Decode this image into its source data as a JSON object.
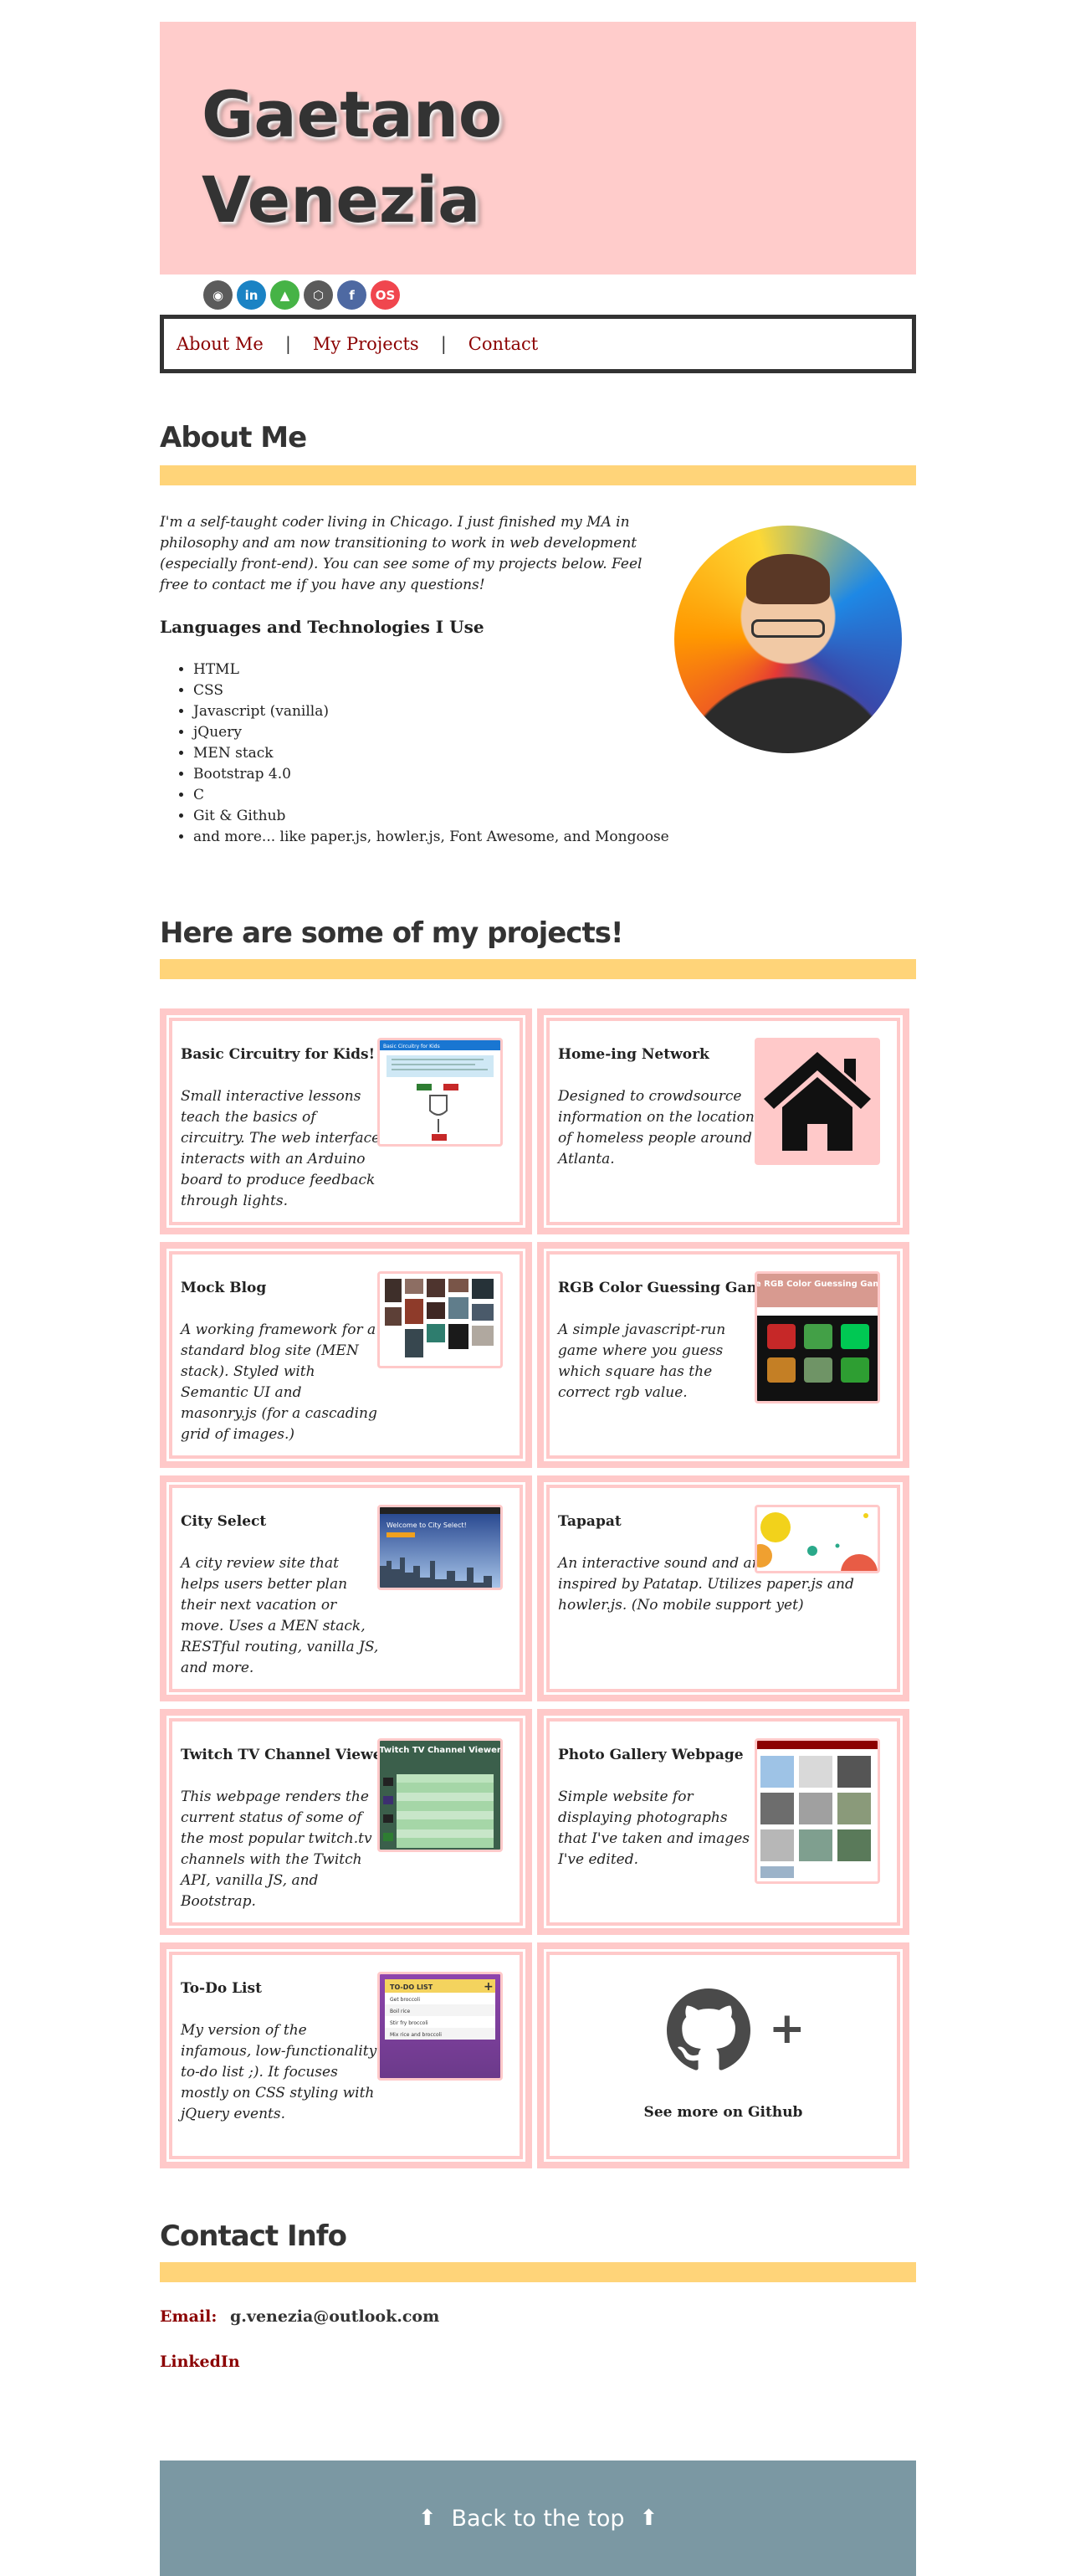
{
  "header": {
    "name_line1": "Gaetano",
    "name_line2": "Venezia"
  },
  "social": [
    {
      "icon": "github-icon",
      "glyph": "◉",
      "color": "#5b5b5b"
    },
    {
      "icon": "linkedin-icon",
      "glyph": "in",
      "color": "#1b83c4"
    },
    {
      "icon": "freecodecamp-icon",
      "glyph": "▲",
      "color": "#46b346"
    },
    {
      "icon": "codepen-icon",
      "glyph": "⬡",
      "color": "#5b5b5b"
    },
    {
      "icon": "facebook-icon",
      "glyph": "f",
      "color": "#4e69a2"
    },
    {
      "icon": "openprocessing-icon",
      "glyph": "OS",
      "color": "#f0464e"
    }
  ],
  "nav": {
    "about": "About Me",
    "sep": "|",
    "projects": "My Projects",
    "contact": "Contact"
  },
  "about": {
    "title": "About Me",
    "intro": "I'm a self-taught coder living in Chicago. I just finished my MA in philosophy and am now transitioning to work in web development (especially front-end). You can see some of my projects below. Feel free to contact me if you have any questions!",
    "lang_title": "Languages and Technologies I Use",
    "languages": [
      "HTML",
      "CSS",
      "Javascript (vanilla)",
      "jQuery",
      "MEN stack",
      "Bootstrap 4.0",
      "C",
      "Git & Github",
      "and more... like paper.js, howler.js, Font Awesome, and Mongoose"
    ]
  },
  "projects": {
    "title": "Here are some of my projects!",
    "items": [
      {
        "title": "Basic Circuitry for Kids!",
        "desc": "Small interactive lessons teach the basics of circuitry. The web interface interacts with an Arduino board to produce feedback through lights."
      },
      {
        "title": "Home-ing Network",
        "desc": "Designed to crowdsource information on the location of homeless people around Atlanta."
      },
      {
        "title": "Mock Blog",
        "desc": "A working framework for a standard blog site (MEN stack). Styled with Semantic UI and masonry.js (for a cascading grid of images.)"
      },
      {
        "title": "RGB Color Guessing Game",
        "desc": "A simple javascript-run game where you guess which square has the correct rgb value."
      },
      {
        "title": "City Select",
        "desc": "A city review site that helps users better plan their next vacation or move. Uses a MEN stack, RESTful routing, vanilla JS, and more."
      },
      {
        "title": "Tapapat",
        "desc": "An interactive sound and animation kit inspired by Patatap. Utilizes paper.js and howler.js. (No mobile support yet)"
      },
      {
        "title": "Twitch TV Channel Viewer",
        "desc": "This webpage renders the current status of some of the most popular twitch.tv channels with the Twitch API, vanilla JS, and Bootstrap."
      },
      {
        "title": "Photo Gallery Webpage",
        "desc": "Simple website for displaying photographs that I've taken and images I've edited."
      },
      {
        "title": "To-Do List",
        "desc": "My version of the infamous, low-functionality to-do list ;). It focuses mostly on CSS styling with jQuery events."
      }
    ],
    "github_more": "See more on Github",
    "thumb_text": {
      "circuit_head": "Basic Circuitry for Kids",
      "rgb_head": "The RGB Color Guessing Game!",
      "city_head": "Welcome to City Select!",
      "twitch_head": "Twitch TV Channel Viewer",
      "todo_head": "TO-DO LIST",
      "todo_items": [
        "Get broccoli",
        "Boil rice",
        "Stir fry broccoli",
        "Mix rice and broccoli"
      ]
    }
  },
  "contact": {
    "title": "Contact Info",
    "email_label": "Email:",
    "email": "g.venezia@outlook.com",
    "linkedin": "LinkedIn"
  },
  "footer": {
    "label": "Back to the top",
    "arrow": "⬆"
  }
}
